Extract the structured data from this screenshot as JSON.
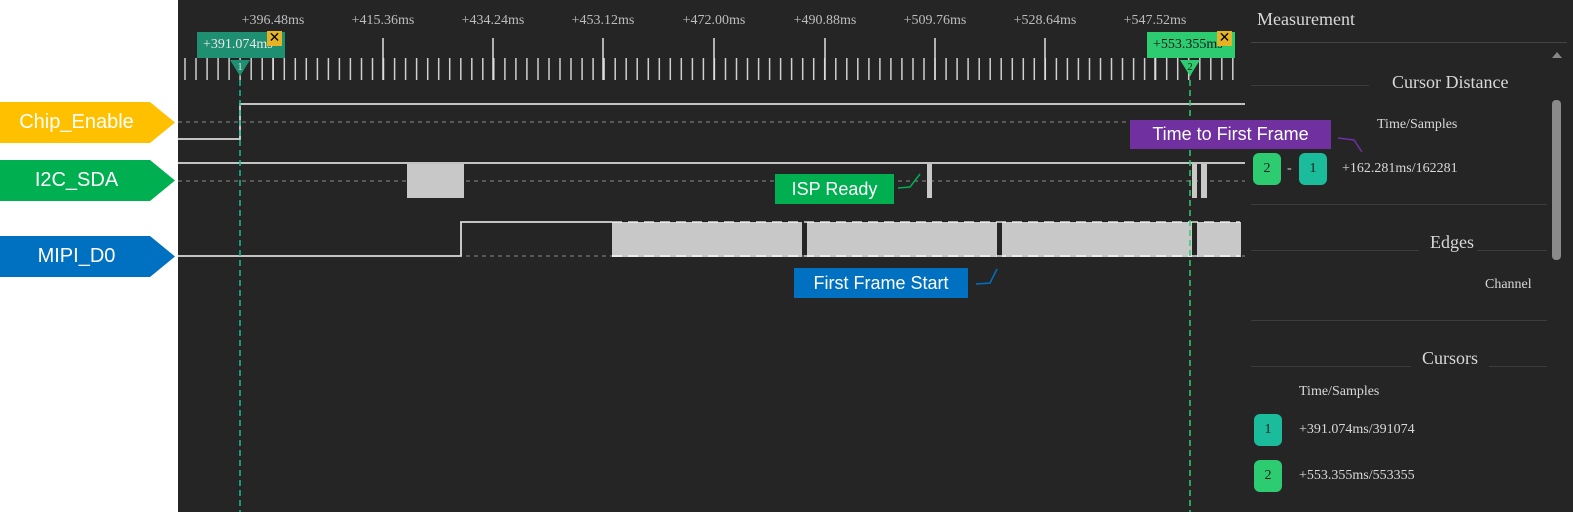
{
  "channels": [
    {
      "name": "Chip_Enable",
      "color": "#ffc000"
    },
    {
      "name": "I2C_SDA",
      "color": "#00b050"
    },
    {
      "name": "MIPI_D0",
      "color": "#0070c0"
    }
  ],
  "timeline": {
    "ticks": [
      "+396.48ms",
      "+415.36ms",
      "+434.24ms",
      "+453.12ms",
      "+472.00ms",
      "+490.88ms",
      "+509.76ms",
      "+528.64ms",
      "+547.52ms"
    ]
  },
  "cursors": [
    {
      "id": "1",
      "time": "+391.074ms",
      "color": "#1abc9c"
    },
    {
      "id": "2",
      "time": "+553.355ms",
      "color": "#2ecc71"
    }
  ],
  "annotations": {
    "isp_ready": {
      "text": "ISP Ready",
      "color": "#00b050"
    },
    "first_frame_start": {
      "text": "First Frame Start",
      "color": "#0070c0"
    },
    "time_to_first_frame": {
      "text": "Time to First Frame",
      "color": "#7030a0"
    }
  },
  "panel": {
    "title": "Measurement",
    "cursor_distance": {
      "title": "Cursor Distance",
      "header": "Time/Samples",
      "from": "2",
      "separator": "-",
      "to": "1",
      "value": "+162.281ms/162281"
    },
    "edges": {
      "title": "Edges",
      "header": "Channel"
    },
    "cursors": {
      "title": "Cursors",
      "header": "Time/Samples",
      "rows": [
        {
          "id": "1",
          "value": "+391.074ms/391074"
        },
        {
          "id": "2",
          "value": "+553.355ms/553355"
        }
      ]
    }
  }
}
